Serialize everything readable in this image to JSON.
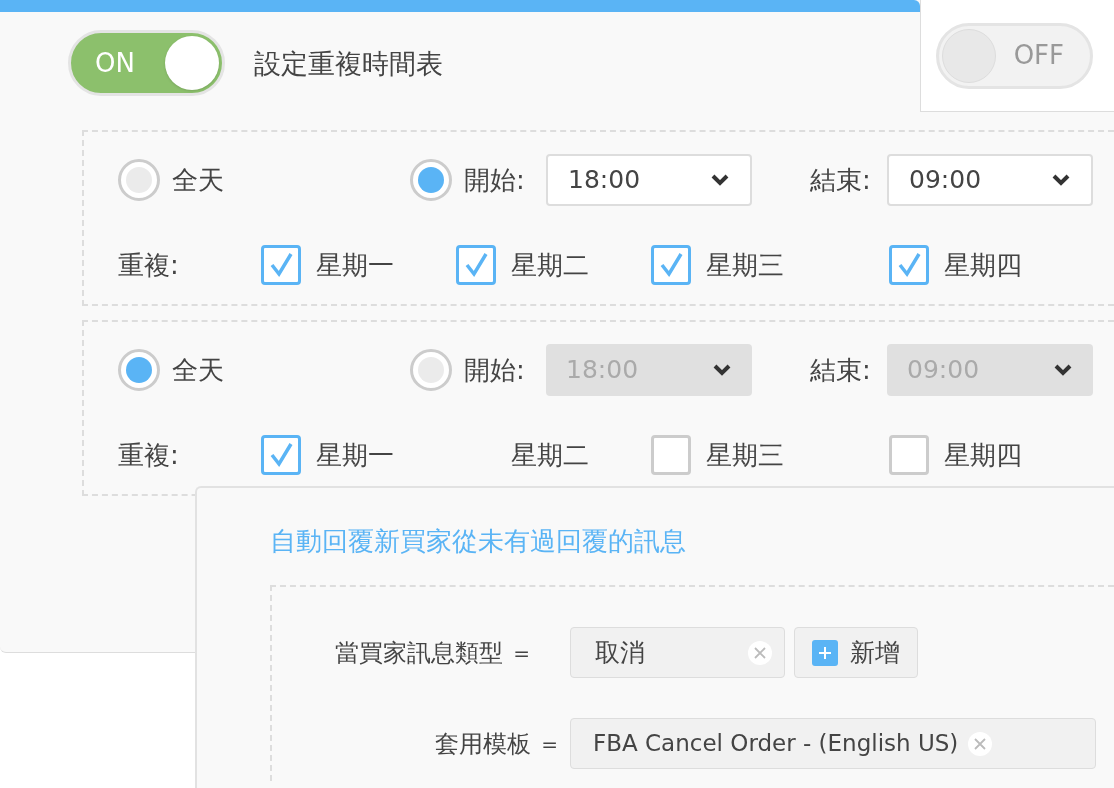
{
  "main_toggle": {
    "label": "ON",
    "on": true
  },
  "title": "設定重複時間表",
  "side_toggle": {
    "label": "OFF",
    "on": false
  },
  "schedules": [
    {
      "all_day": {
        "label": "全天",
        "selected": false
      },
      "start": {
        "label": "開始:",
        "selected": true,
        "value": "18:00",
        "disabled": false
      },
      "end": {
        "label": "結束:",
        "value": "09:00",
        "disabled": false
      },
      "repeat_label": "重複:",
      "days": [
        {
          "kind": "checkbox",
          "label": "星期一",
          "checked": true
        },
        {
          "kind": "checkbox",
          "label": "星期二",
          "checked": true
        },
        {
          "kind": "checkbox",
          "label": "星期三",
          "checked": true
        },
        {
          "kind": "checkbox",
          "label": "星期四",
          "checked": true
        }
      ]
    },
    {
      "all_day": {
        "label": "全天",
        "selected": true
      },
      "start": {
        "label": "開始:",
        "selected": false,
        "value": "18:00",
        "disabled": true
      },
      "end": {
        "label": "結束:",
        "value": "09:00",
        "disabled": true
      },
      "repeat_label": "重複:",
      "days": [
        {
          "kind": "checkbox",
          "label": "星期一",
          "checked": true
        },
        {
          "kind": "plain",
          "label": "星期二"
        },
        {
          "kind": "checkbox",
          "label": "星期三",
          "checked": false
        },
        {
          "kind": "checkbox",
          "label": "星期四",
          "checked": false
        }
      ]
    }
  ],
  "panel": {
    "title": "自動回覆新買家從未有過回覆的訊息",
    "message_type": {
      "label": "當買家訊息類型",
      "equals": "=",
      "tag": "取消",
      "add_button": "新增"
    },
    "template": {
      "label": "套用模板",
      "equals": "=",
      "value": "FBA Cancel Order - (English US)"
    }
  }
}
